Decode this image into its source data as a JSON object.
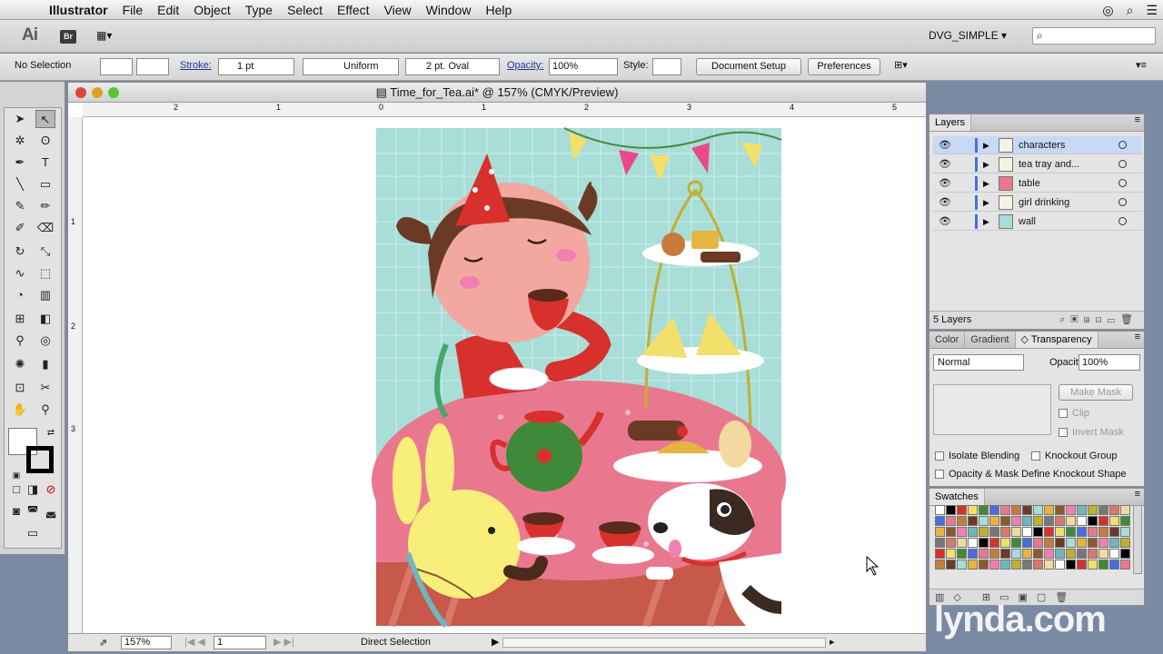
{
  "menubar": {
    "app": "Illustrator",
    "items": [
      "File",
      "Edit",
      "Object",
      "Type",
      "Select",
      "Effect",
      "View",
      "Window",
      "Help"
    ]
  },
  "appbar": {
    "logo": "Ai",
    "bridge": "Br",
    "workspace": "DVG_SIMPLE ▾",
    "search_placeholder": ""
  },
  "control": {
    "selection": "No Selection",
    "stroke_label": "Stroke:",
    "stroke_weight": "1 pt",
    "profile": "Uniform",
    "brush": "2 pt. Oval",
    "opacity_label": "Opacity:",
    "opacity": "100%",
    "style_label": "Style:",
    "doc_setup": "Document Setup",
    "prefs": "Preferences"
  },
  "document": {
    "title": "Time_for_Tea.ai* @ 157% (CMYK/Preview)",
    "ruler_top": [
      "2",
      "1",
      "0",
      "1",
      "2",
      "3",
      "4",
      "5"
    ],
    "ruler_left": [
      "1",
      "2",
      "3"
    ],
    "zoom": "157%",
    "page": "1",
    "status_tool": "Direct Selection"
  },
  "layers_panel": {
    "tab": "Layers",
    "layers": [
      {
        "name": "characters",
        "selected": true
      },
      {
        "name": "tea tray and...",
        "selected": false
      },
      {
        "name": "table",
        "selected": false
      },
      {
        "name": "girl drinking",
        "selected": false
      },
      {
        "name": "wall",
        "selected": false
      }
    ],
    "count": "5 Layers"
  },
  "transparency_panel": {
    "tabs": [
      "Color",
      "Gradient",
      "◇ Transparency"
    ],
    "blend": "Normal",
    "opacity_label": "Opacity:",
    "opacity": "100%",
    "make_mask": "Make Mask",
    "clip": "Clip",
    "invert": "Invert Mask",
    "isolate": "Isolate Blending",
    "knockout": "Knockout Group",
    "opacity_mask": "Opacity & Mask Define Knockout Shape"
  },
  "swatches_panel": {
    "tab": "Swatches"
  },
  "watermark": "lynda.com",
  "colors": {
    "wall": "#a8ddd8",
    "table": "#e9788f",
    "floor": "#c6594a",
    "girl_dress": "#d8302d",
    "accent_blue": "#4b6ce0"
  }
}
